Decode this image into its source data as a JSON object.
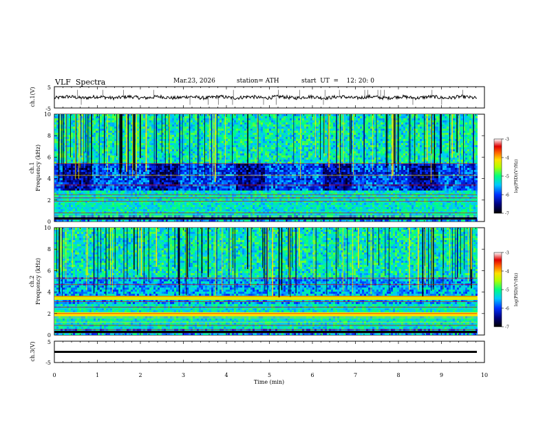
{
  "header": {
    "title": "VLF  Spectra",
    "date": "Mar.23, 2026",
    "station": "station= ATH",
    "start": "start  UT  =    12: 20: 0"
  },
  "chart_data": [
    {
      "type": "line",
      "panel": "ch1-waveform",
      "ylabel": "ch.1(V)",
      "ylim": [
        -5,
        5
      ],
      "yticks": [
        "5",
        "-5"
      ],
      "xlim": [
        0,
        10
      ],
      "baseline_value": 0
    },
    {
      "type": "heatmap",
      "panel": "ch1-spectrogram",
      "ylabel_line1": "ch.1",
      "ylabel_line2": "Frequency  (kHz)",
      "ylim": [
        0,
        10
      ],
      "yticks": [
        "0",
        "2",
        "4",
        "6",
        "8",
        "10"
      ],
      "xlim": [
        0,
        10
      ],
      "colorbar": {
        "label": "log(PSD)(V²/Hz)",
        "range": [
          -7,
          -3
        ],
        "ticks": [
          "-3",
          "-4",
          "-5",
          "-6",
          "-7"
        ]
      }
    },
    {
      "type": "heatmap",
      "panel": "ch2-spectrogram",
      "ylabel_line1": "ch.2",
      "ylabel_line2": "Frequency  (kHz)",
      "ylim": [
        0,
        10
      ],
      "yticks": [
        "0",
        "2",
        "4",
        "6",
        "8",
        "10"
      ],
      "xlim": [
        0,
        10
      ],
      "colorbar": {
        "label": "log(PSD)(V²/Hz)",
        "range": [
          -7,
          -3
        ],
        "ticks": [
          "-3",
          "-4",
          "-5",
          "-6",
          "-7"
        ]
      }
    },
    {
      "type": "line",
      "panel": "ch3-waveform",
      "ylabel": "ch.3(V)",
      "ylim": [
        -5,
        5
      ],
      "yticks": [
        "5",
        "-5"
      ],
      "xlim": [
        0,
        10
      ],
      "baseline_value": -1.2
    }
  ],
  "xaxis": {
    "label": "Time  (min)",
    "ticks": [
      "0",
      "1",
      "2",
      "3",
      "4",
      "5",
      "6",
      "7",
      "8",
      "9",
      "10"
    ]
  }
}
